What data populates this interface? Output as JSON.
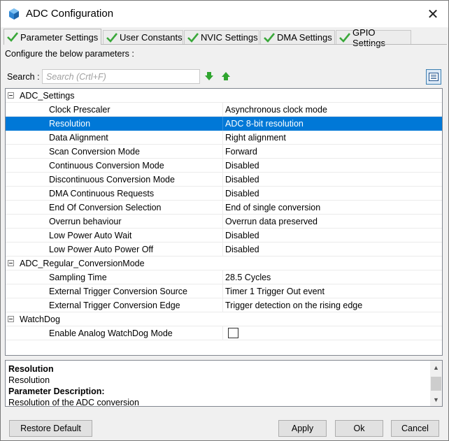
{
  "window": {
    "title": "ADC Configuration"
  },
  "tabs": [
    {
      "label": "Parameter Settings",
      "active": true
    },
    {
      "label": "User Constants",
      "active": false
    },
    {
      "label": "NVIC Settings",
      "active": false
    },
    {
      "label": "DMA Settings",
      "active": false
    },
    {
      "label": "GPIO Settings",
      "active": false
    }
  ],
  "configure_label": "Configure the below parameters :",
  "search": {
    "label": "Search :",
    "placeholder": "Search (Crtl+F)"
  },
  "groups": [
    {
      "name": "ADC_Settings",
      "params": [
        {
          "name": "Clock Prescaler",
          "value": "Asynchronous clock mode"
        },
        {
          "name": "Resolution",
          "value": "ADC 8-bit resolution",
          "selected": true
        },
        {
          "name": "Data Alignment",
          "value": "Right alignment"
        },
        {
          "name": "Scan Conversion Mode",
          "value": "Forward"
        },
        {
          "name": "Continuous Conversion Mode",
          "value": "Disabled"
        },
        {
          "name": "Discontinuous Conversion Mode",
          "value": "Disabled"
        },
        {
          "name": "DMA Continuous Requests",
          "value": "Disabled"
        },
        {
          "name": "End Of Conversion Selection",
          "value": "End of single conversion"
        },
        {
          "name": "Overrun behaviour",
          "value": "Overrun data preserved"
        },
        {
          "name": "Low Power Auto Wait",
          "value": "Disabled"
        },
        {
          "name": "Low Power Auto Power Off",
          "value": "Disabled"
        }
      ]
    },
    {
      "name": "ADC_Regular_ConversionMode",
      "params": [
        {
          "name": "Sampling Time",
          "value": "28.5 Cycles"
        },
        {
          "name": "External Trigger Conversion Source",
          "value": "Timer 1 Trigger Out event"
        },
        {
          "name": "External Trigger Conversion Edge",
          "value": "Trigger detection on the rising edge"
        }
      ]
    },
    {
      "name": "WatchDog",
      "params": [
        {
          "name": "Enable Analog WatchDog Mode",
          "value": "",
          "checkbox": true,
          "checked": false
        }
      ]
    }
  ],
  "description": {
    "title": "Resolution",
    "subtitle": "Resolution",
    "heading": "Parameter Description:",
    "text": "Resolution of the ADC conversion"
  },
  "buttons": {
    "restore_default": "Restore Default",
    "apply": "Apply",
    "ok": "Ok",
    "cancel": "Cancel"
  },
  "colors": {
    "selection": "#0078d7",
    "check_green": "#3aa83a",
    "arrow_green": "#2fa52f"
  },
  "icons": {
    "app": "cube-icon",
    "tab_status": "check-icon",
    "search_next": "arrow-down-icon",
    "search_prev": "arrow-up-icon",
    "view_toggle": "list-view-icon",
    "group_toggle": "collapse-icon"
  }
}
